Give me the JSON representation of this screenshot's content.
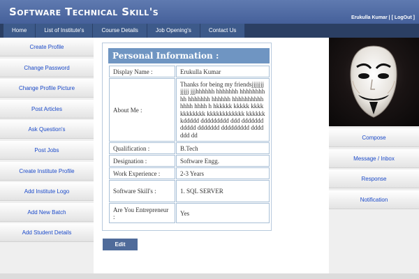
{
  "header": {
    "title": "Software Technical Skill's",
    "user_name": "Erukulla Kumar",
    "separator": "|",
    "logout": "[ LogOut ]"
  },
  "nav": {
    "items": [
      "Home",
      "List of Institute's",
      "Course Details",
      "Job Opening's",
      "Contact Us"
    ]
  },
  "left_menu": {
    "items": [
      "Create Profile",
      "Change Password",
      "Change Profile Picture",
      "Post Articles",
      "Ask Question's",
      "Post Jobs",
      "Create Institute Profile",
      "Add Institute Logo",
      "Add New Batch",
      "Add Student Details"
    ]
  },
  "right_menu": {
    "items": [
      "Compose",
      "Message / Inbox",
      "Response",
      "Notification"
    ]
  },
  "profile": {
    "heading": "Personal Information :",
    "rows": [
      {
        "label": "Display Name :",
        "value": "Erukulla Kumar"
      },
      {
        "label": "About Me :",
        "value": "Thanks for being my friendsjjjjjjjjjjjj jjjhhhhhh hhhhhhh hhhhhhhhhh hhhhhhh hhhhhh hhhhhhhhhhhhhh hhhh h hkkkkk kkkkk kkkk kkkkkkkk kkkkkkkkkkkk kkkkkk kddddd ddddddddd ddd ddddddd ddddd ddddddd ddddddddd ddddddd dd"
      },
      {
        "label": "Qualification :",
        "value": "B.Tech"
      },
      {
        "label": "Designation :",
        "value": "Software Engg."
      },
      {
        "label": "Work Experience :",
        "value": "2-3 Years"
      },
      {
        "label": "Software Skill's :",
        "value": "1. SQL SERVER"
      },
      {
        "label": "Are You Entrepreneur :",
        "value": "Yes"
      }
    ],
    "edit_label": "Edit"
  },
  "colors": {
    "header_bg": "#4f6ba3",
    "nav_bg": "#3d5a8a",
    "link": "#1a49c9",
    "panel_head": "#6f95c2"
  },
  "icons": {
    "avatar": "guy-fawkes-mask-icon"
  }
}
